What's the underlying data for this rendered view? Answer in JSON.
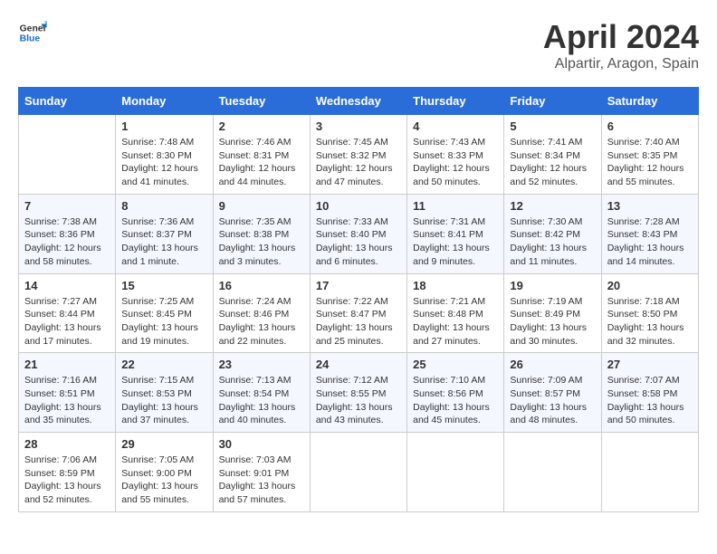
{
  "header": {
    "logo_line1": "General",
    "logo_line2": "Blue",
    "month": "April 2024",
    "location": "Alpartir, Aragon, Spain"
  },
  "columns": [
    "Sunday",
    "Monday",
    "Tuesday",
    "Wednesday",
    "Thursday",
    "Friday",
    "Saturday"
  ],
  "weeks": [
    [
      {
        "day": "",
        "info": ""
      },
      {
        "day": "1",
        "info": "Sunrise: 7:48 AM\nSunset: 8:30 PM\nDaylight: 12 hours\nand 41 minutes."
      },
      {
        "day": "2",
        "info": "Sunrise: 7:46 AM\nSunset: 8:31 PM\nDaylight: 12 hours\nand 44 minutes."
      },
      {
        "day": "3",
        "info": "Sunrise: 7:45 AM\nSunset: 8:32 PM\nDaylight: 12 hours\nand 47 minutes."
      },
      {
        "day": "4",
        "info": "Sunrise: 7:43 AM\nSunset: 8:33 PM\nDaylight: 12 hours\nand 50 minutes."
      },
      {
        "day": "5",
        "info": "Sunrise: 7:41 AM\nSunset: 8:34 PM\nDaylight: 12 hours\nand 52 minutes."
      },
      {
        "day": "6",
        "info": "Sunrise: 7:40 AM\nSunset: 8:35 PM\nDaylight: 12 hours\nand 55 minutes."
      }
    ],
    [
      {
        "day": "7",
        "info": "Sunrise: 7:38 AM\nSunset: 8:36 PM\nDaylight: 12 hours\nand 58 minutes."
      },
      {
        "day": "8",
        "info": "Sunrise: 7:36 AM\nSunset: 8:37 PM\nDaylight: 13 hours\nand 1 minute."
      },
      {
        "day": "9",
        "info": "Sunrise: 7:35 AM\nSunset: 8:38 PM\nDaylight: 13 hours\nand 3 minutes."
      },
      {
        "day": "10",
        "info": "Sunrise: 7:33 AM\nSunset: 8:40 PM\nDaylight: 13 hours\nand 6 minutes."
      },
      {
        "day": "11",
        "info": "Sunrise: 7:31 AM\nSunset: 8:41 PM\nDaylight: 13 hours\nand 9 minutes."
      },
      {
        "day": "12",
        "info": "Sunrise: 7:30 AM\nSunset: 8:42 PM\nDaylight: 13 hours\nand 11 minutes."
      },
      {
        "day": "13",
        "info": "Sunrise: 7:28 AM\nSunset: 8:43 PM\nDaylight: 13 hours\nand 14 minutes."
      }
    ],
    [
      {
        "day": "14",
        "info": "Sunrise: 7:27 AM\nSunset: 8:44 PM\nDaylight: 13 hours\nand 17 minutes."
      },
      {
        "day": "15",
        "info": "Sunrise: 7:25 AM\nSunset: 8:45 PM\nDaylight: 13 hours\nand 19 minutes."
      },
      {
        "day": "16",
        "info": "Sunrise: 7:24 AM\nSunset: 8:46 PM\nDaylight: 13 hours\nand 22 minutes."
      },
      {
        "day": "17",
        "info": "Sunrise: 7:22 AM\nSunset: 8:47 PM\nDaylight: 13 hours\nand 25 minutes."
      },
      {
        "day": "18",
        "info": "Sunrise: 7:21 AM\nSunset: 8:48 PM\nDaylight: 13 hours\nand 27 minutes."
      },
      {
        "day": "19",
        "info": "Sunrise: 7:19 AM\nSunset: 8:49 PM\nDaylight: 13 hours\nand 30 minutes."
      },
      {
        "day": "20",
        "info": "Sunrise: 7:18 AM\nSunset: 8:50 PM\nDaylight: 13 hours\nand 32 minutes."
      }
    ],
    [
      {
        "day": "21",
        "info": "Sunrise: 7:16 AM\nSunset: 8:51 PM\nDaylight: 13 hours\nand 35 minutes."
      },
      {
        "day": "22",
        "info": "Sunrise: 7:15 AM\nSunset: 8:53 PM\nDaylight: 13 hours\nand 37 minutes."
      },
      {
        "day": "23",
        "info": "Sunrise: 7:13 AM\nSunset: 8:54 PM\nDaylight: 13 hours\nand 40 minutes."
      },
      {
        "day": "24",
        "info": "Sunrise: 7:12 AM\nSunset: 8:55 PM\nDaylight: 13 hours\nand 43 minutes."
      },
      {
        "day": "25",
        "info": "Sunrise: 7:10 AM\nSunset: 8:56 PM\nDaylight: 13 hours\nand 45 minutes."
      },
      {
        "day": "26",
        "info": "Sunrise: 7:09 AM\nSunset: 8:57 PM\nDaylight: 13 hours\nand 48 minutes."
      },
      {
        "day": "27",
        "info": "Sunrise: 7:07 AM\nSunset: 8:58 PM\nDaylight: 13 hours\nand 50 minutes."
      }
    ],
    [
      {
        "day": "28",
        "info": "Sunrise: 7:06 AM\nSunset: 8:59 PM\nDaylight: 13 hours\nand 52 minutes."
      },
      {
        "day": "29",
        "info": "Sunrise: 7:05 AM\nSunset: 9:00 PM\nDaylight: 13 hours\nand 55 minutes."
      },
      {
        "day": "30",
        "info": "Sunrise: 7:03 AM\nSunset: 9:01 PM\nDaylight: 13 hours\nand 57 minutes."
      },
      {
        "day": "",
        "info": ""
      },
      {
        "day": "",
        "info": ""
      },
      {
        "day": "",
        "info": ""
      },
      {
        "day": "",
        "info": ""
      }
    ]
  ]
}
